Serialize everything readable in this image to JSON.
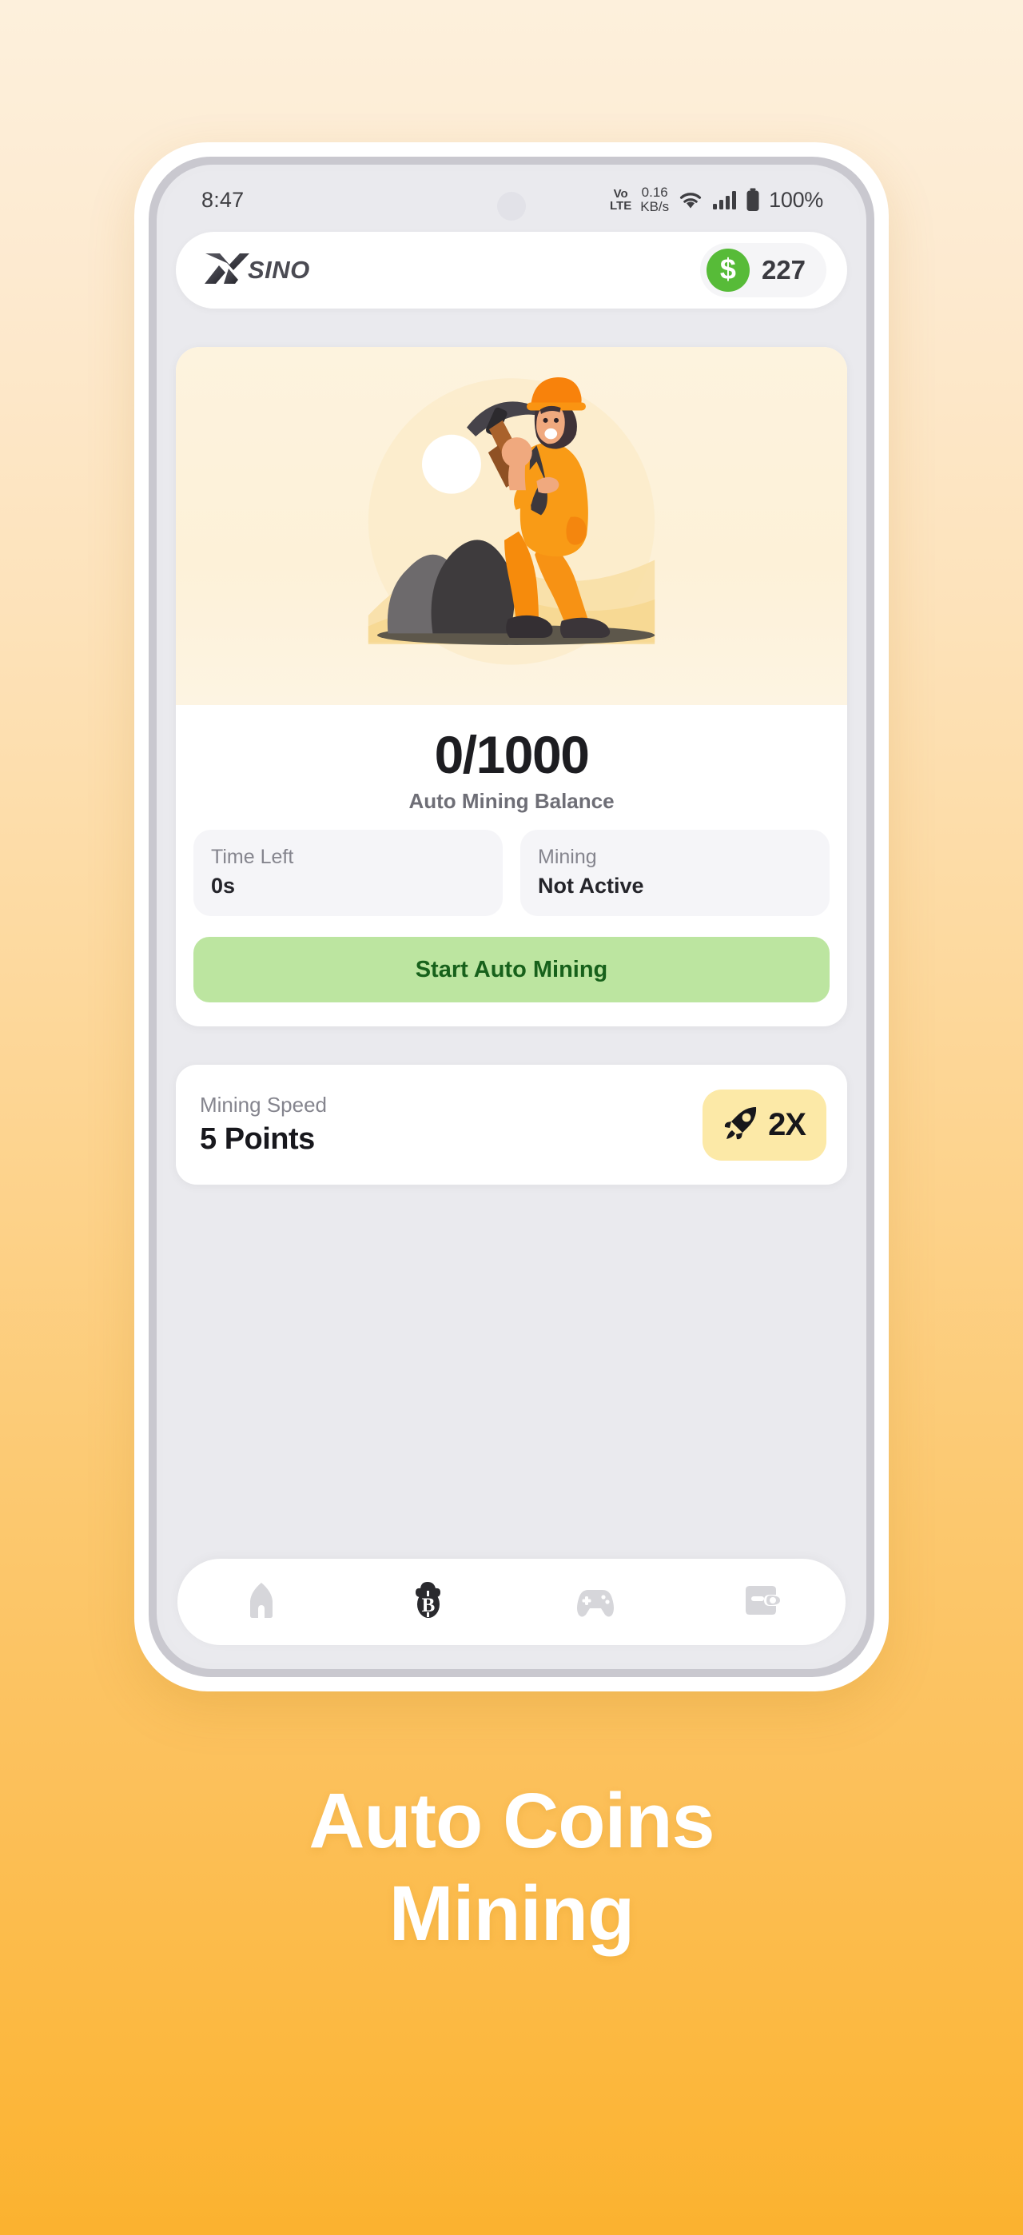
{
  "page": {
    "background_top_color": "#FDF0DC",
    "background_bottom_color": "#FBB22F"
  },
  "caption": {
    "line1": "Auto Coins",
    "line2": "Mining",
    "color": "#FFFFFF"
  },
  "statusbar": {
    "time": "8:47",
    "volte_line1": "Vo",
    "volte_line2": "LTE",
    "network_speed_value": "0.16",
    "network_speed_unit": "KB/s",
    "wifi_icon": "wifi-icon",
    "signal_icon": "cellular-signal-icon",
    "battery_icon": "battery-full-icon",
    "battery_percent": "100%"
  },
  "header": {
    "logo_mark": "x-logo-icon",
    "logo_text": "SINO",
    "coin_icon": "dollar-coin-icon",
    "balance": "227",
    "coin_color": "#57BB38"
  },
  "main_card": {
    "illustration_name": "miner-with-pickaxe-illustration",
    "balance_value": "0/1000",
    "balance_label": "Auto Mining Balance",
    "stats": [
      {
        "title": "Time Left",
        "value": "0s",
        "name": "time-left"
      },
      {
        "title": "Mining",
        "value": "Not Active",
        "name": "mining-status"
      }
    ],
    "start_button_label": "Start Auto Mining",
    "start_button_bg": "#BCE5A0",
    "start_button_color": "#17611B"
  },
  "speed_card": {
    "label": "Mining Speed",
    "value": "5 Points",
    "boost_icon": "rocket-icon",
    "boost_label": "2X",
    "boost_bg": "#FCE9A7"
  },
  "bottom_nav": {
    "items": [
      {
        "name": "nav-home",
        "icon": "home-icon",
        "active": false
      },
      {
        "name": "nav-cloud-mining",
        "icon": "cloud-bitcoin-icon",
        "active": true
      },
      {
        "name": "nav-games",
        "icon": "gamepad-icon",
        "active": false
      },
      {
        "name": "nav-wallet",
        "icon": "wallet-icon",
        "active": false
      }
    ],
    "inactive_color": "#D6D6DA",
    "active_color": "#2A2A2E"
  }
}
